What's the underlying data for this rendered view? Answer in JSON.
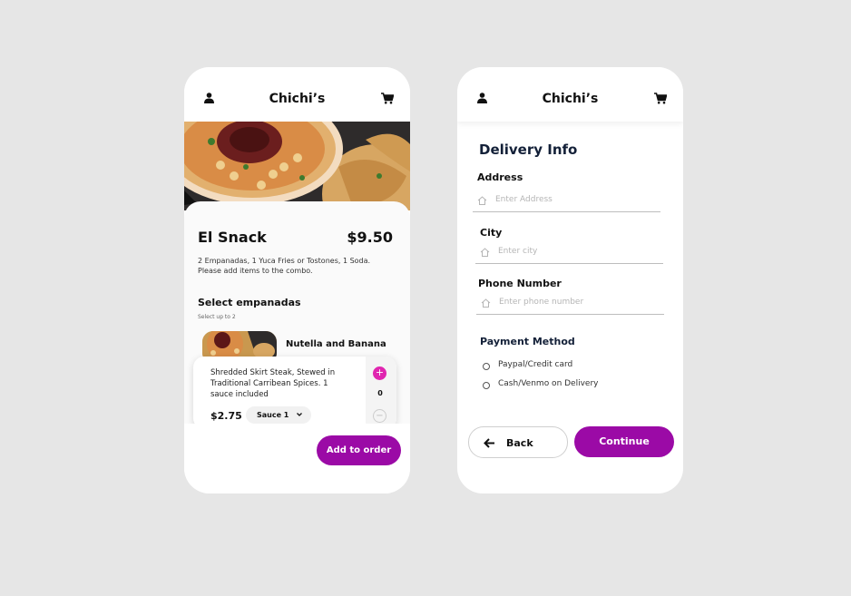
{
  "colors": {
    "accent": "#9b0aa6",
    "plus": "#e026b0",
    "heading": "#132038"
  },
  "order_screen": {
    "header": {
      "title": "Chichi’s",
      "left_icon": "user-icon",
      "right_icon": "cart-icon"
    },
    "item": {
      "name": "El Snack",
      "price": "$9.50",
      "description": "2 Empanadas, 1 Yuca Fries or Tostones, 1 Soda. Please add items to the combo."
    },
    "selection": {
      "title": "Select empanadas",
      "subtitle": "Select up to 2"
    },
    "empanadas": [
      {
        "name": "Nutella and Banana"
      },
      {
        "description": "Shredded Skirt Steak, Stewed in Traditional Carribean Spices. 1 sauce included",
        "price": "$2.75",
        "sauce": "Sauce 1",
        "plus": "+",
        "count": "0",
        "minus": "−"
      }
    ],
    "add_button": "Add to order"
  },
  "delivery_screen": {
    "header": {
      "title": "Chichi’s",
      "left_icon": "user-icon",
      "right_icon": "cart-icon"
    },
    "title": "Delivery Info",
    "fields": [
      {
        "label": "Address",
        "placeholder": "Enter Address",
        "icon": "house-icon"
      },
      {
        "label": "City",
        "placeholder": "Enter city",
        "icon": "house-icon"
      },
      {
        "label": "Phone Number",
        "placeholder": "Enter phone number",
        "icon": "house-icon"
      }
    ],
    "payment": {
      "title": "Payment Method",
      "options": [
        "Paypal/Credit card",
        "Cash/Venmo on Delivery"
      ]
    },
    "back_button": "Back",
    "continue_button": "Continue"
  }
}
